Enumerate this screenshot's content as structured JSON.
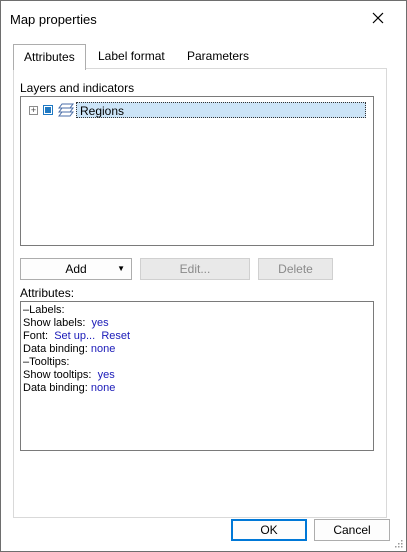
{
  "window": {
    "title": "Map properties"
  },
  "tabs": [
    {
      "label": "Attributes",
      "active": true
    },
    {
      "label": "Label format",
      "active": false
    },
    {
      "label": "Parameters",
      "active": false
    }
  ],
  "layers": {
    "heading": "Layers and indicators",
    "expander": "+",
    "node": {
      "label": "Regions",
      "checked": true
    }
  },
  "layer_buttons": {
    "add": "Add",
    "edit": "Edit...",
    "delete": "Delete"
  },
  "attributes": {
    "heading": "Attributes:",
    "labels_group": "Labels:",
    "show_labels": {
      "name": "Show labels:",
      "value": "yes"
    },
    "font": {
      "name": "Font:",
      "setup": "Set up...",
      "reset": "Reset"
    },
    "labels_binding": {
      "name": "Data binding:",
      "value": "none"
    },
    "tooltips_group": "Tooltips:",
    "show_tooltips": {
      "name": "Show tooltips:",
      "value": "yes"
    },
    "tooltips_binding": {
      "name": "Data binding:",
      "value": "none"
    },
    "collapse_glyph": "–"
  },
  "footer": {
    "ok": "OK",
    "cancel": "Cancel"
  },
  "colors": {
    "selection": "#cce4f7",
    "link": "#1a1ab8",
    "accent": "#0078d7"
  }
}
